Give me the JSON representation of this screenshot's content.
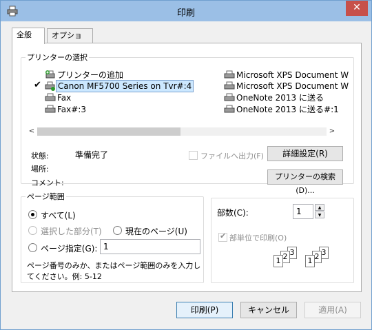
{
  "window": {
    "title": "印刷",
    "close_glyph": "✕"
  },
  "tabs": [
    {
      "label": "全般"
    },
    {
      "label": "オプション"
    }
  ],
  "printer_group": {
    "legend": "プリンターの選択",
    "printers_left": [
      {
        "label": "プリンターの追加",
        "icon": "add-printer-icon"
      },
      {
        "label": "Canon MF5700 Series on Tvr#:4",
        "icon": "printer-icon",
        "selected": true
      },
      {
        "label": "Fax",
        "icon": "printer-icon"
      },
      {
        "label": "Fax#:3",
        "icon": "printer-icon"
      }
    ],
    "printers_right": [
      {
        "label": "Microsoft XPS Document W",
        "icon": "printer-icon"
      },
      {
        "label": "Microsoft XPS Document W",
        "icon": "printer-icon"
      },
      {
        "label": "OneNote 2013 に送る",
        "icon": "printer-icon"
      },
      {
        "label": "OneNote 2013 に送る#:1",
        "icon": "printer-icon"
      }
    ],
    "scroll_left": "<",
    "scroll_right": ">",
    "status_label": "状態:",
    "status_value": "準備完了",
    "location_label": "場所:",
    "comment_label": "コメント:",
    "print_to_file": "ファイルへ出力(F)",
    "preferences_button": "詳細設定(R)",
    "find_printer_button": "プリンターの検索(D)..."
  },
  "page_range": {
    "legend": "ページ範囲",
    "all": "すべて(L)",
    "selection": "選択した部分(T)",
    "current_page": "現在のページ(U)",
    "pages": "ページ指定(G):",
    "pages_value": "1",
    "hint_line1": "ページ番号のみか、またはページ範囲のみを入力し",
    "hint_line2": "てください。例: 5-12"
  },
  "copies": {
    "label": "部数(C):",
    "value": "1",
    "collate": "部単位で印刷(O)",
    "collate_pages": [
      "1",
      "2",
      "3"
    ]
  },
  "footer": {
    "print_button": "印刷(P)",
    "cancel_button": "キャンセル",
    "apply_button": "適用(A)"
  }
}
